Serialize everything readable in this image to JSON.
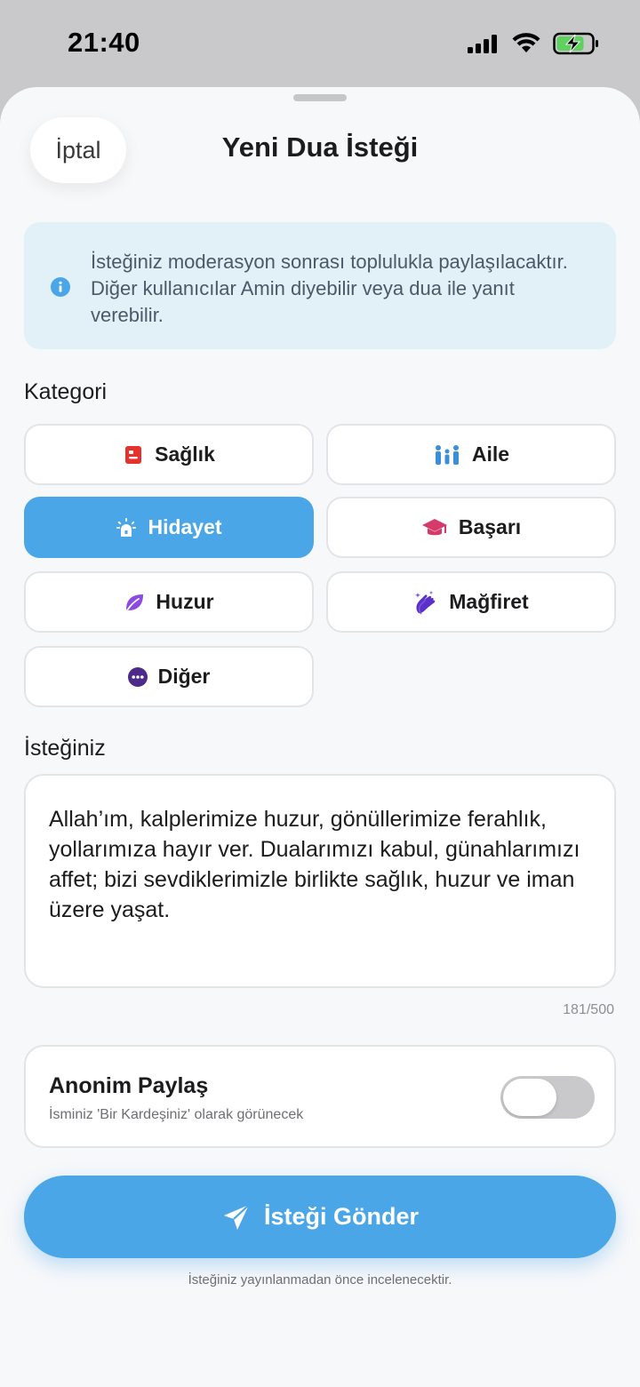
{
  "status_bar": {
    "time": "21:40"
  },
  "header": {
    "cancel_label": "İptal",
    "title": "Yeni Dua İsteği"
  },
  "info": {
    "text": "İsteğiniz moderasyon sonrası toplulukla paylaşılacaktır. Diğer kullanıcılar Amin diyebilir veya dua ile yanıt verebilir."
  },
  "category": {
    "label": "Kategori",
    "selected": "Hidayet",
    "items": [
      {
        "label": "Sağlık",
        "icon": "medical-icon",
        "color": "#e5322d"
      },
      {
        "label": "Aile",
        "icon": "family-icon",
        "color": "#3c8fd6"
      },
      {
        "label": "Hidayet",
        "icon": "light-icon",
        "color": "#ffffff"
      },
      {
        "label": "Başarı",
        "icon": "graduation-cap-icon",
        "color": "#d63a6a"
      },
      {
        "label": "Huzur",
        "icon": "leaf-icon",
        "color": "#8b4be3"
      },
      {
        "label": "Mağfiret",
        "icon": "praying-hands-icon",
        "color": "#5b2fc9"
      },
      {
        "label": "Diğer",
        "icon": "more-icon",
        "color": "#4c2a8a"
      }
    ]
  },
  "request": {
    "label": "İsteğiniz",
    "text": "Allah’ım, kalplerimize huzur, gönüllerimize ferahlık, yollarımıza hayır ver. Dualarımızı kabul, günahlarımızı affet; bizi sevdiklerimizle birlikte sağlık, huzur ve iman üzere yaşat.",
    "char_count": "181/500"
  },
  "anonymous": {
    "title": "Anonim Paylaş",
    "subtitle": "İsminiz 'Bir Kardeşiniz' olarak görünecek",
    "enabled": false
  },
  "submit": {
    "label": "İsteği Gönder"
  },
  "footnote": "İsteğiniz yayınlanmadan önce incelenecektir.",
  "colors": {
    "accent": "#4aa6e7",
    "background": "#f7f8fa",
    "info_bg": "#e2f0f8"
  }
}
